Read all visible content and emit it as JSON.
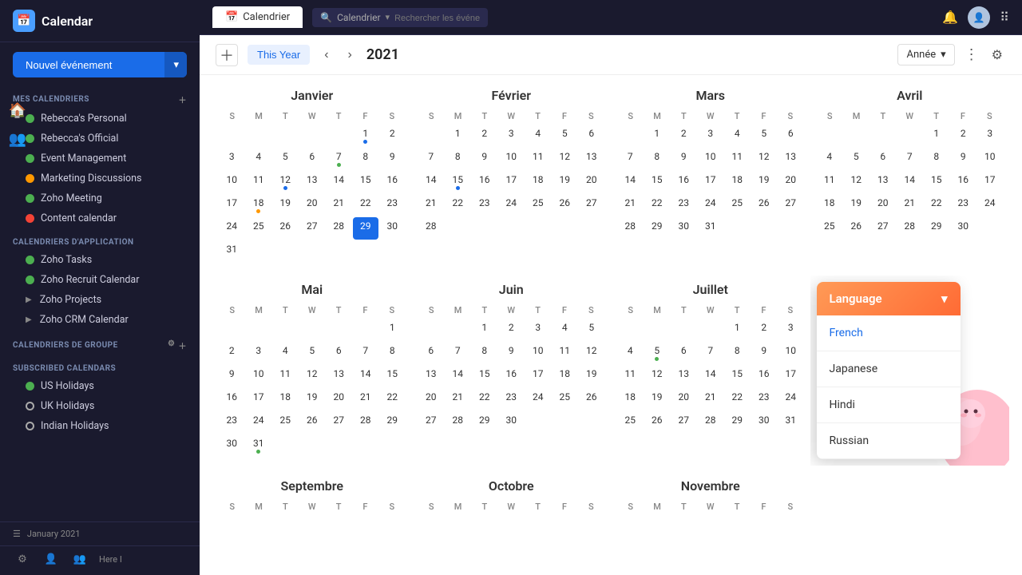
{
  "sidebar": {
    "app_name": "Calendar",
    "new_event_label": "Nouvel événement",
    "my_calendars_title": "MES CALENDRIERS",
    "my_calendars": [
      {
        "label": "Rebecca's Personal",
        "color": "green",
        "type": "dot"
      },
      {
        "label": "Rebecca's Official",
        "color": "green",
        "type": "dot"
      },
      {
        "label": "Event Management",
        "color": "green",
        "type": "dot"
      },
      {
        "label": "Marketing Discussions",
        "color": "orange",
        "type": "dot"
      },
      {
        "label": "Zoho Meeting",
        "color": "green",
        "type": "dot"
      },
      {
        "label": "Content calendar",
        "color": "red",
        "type": "dot"
      }
    ],
    "app_calendars_title": "CALENDRIERS D'APPLICATION",
    "app_calendars": [
      {
        "label": "Zoho Tasks",
        "color": "green",
        "type": "dot"
      },
      {
        "label": "Zoho Recruit Calendar",
        "color": "green",
        "type": "dot"
      },
      {
        "label": "Zoho Projects",
        "type": "arrow"
      },
      {
        "label": "Zoho CRM Calendar",
        "type": "arrow"
      }
    ],
    "group_calendars_title": "CALENDRIERS DE GROUPE",
    "subscribed_calendars_title": "SUBSCRIBED CALENDARS",
    "subscribed_calendars": [
      {
        "label": "US Holidays",
        "color": "green",
        "type": "dot"
      },
      {
        "label": "UK Holidays",
        "color": "outline",
        "type": "dot"
      },
      {
        "label": "Indian Holidays",
        "color": "outline",
        "type": "dot"
      }
    ],
    "mini_nav_label": "January 2021"
  },
  "topbar": {
    "tab_label": "Calendrier",
    "search_placeholder": "Rechercher les événeme...",
    "app_name": "Calendrier"
  },
  "toolbar": {
    "this_year": "This Year",
    "year": "2021",
    "view_label": "Année"
  },
  "months": [
    {
      "name": "Janvier",
      "days_header": [
        "S",
        "M",
        "T",
        "W",
        "T",
        "F",
        "S"
      ],
      "weeks": [
        [
          null,
          null,
          null,
          null,
          null,
          1,
          2
        ],
        [
          3,
          4,
          5,
          6,
          7,
          8,
          9
        ],
        [
          10,
          11,
          12,
          13,
          14,
          15,
          16
        ],
        [
          17,
          18,
          19,
          20,
          21,
          22,
          23
        ],
        [
          24,
          25,
          26,
          27,
          28,
          29,
          30
        ],
        [
          31,
          null,
          null,
          null,
          null,
          null,
          null
        ]
      ],
      "dots": {
        "1": "blue",
        "7": "green",
        "12": "blue",
        "18": "orange",
        "29": "today"
      }
    },
    {
      "name": "Février",
      "days_header": [
        "S",
        "M",
        "T",
        "W",
        "T",
        "F",
        "S"
      ],
      "weeks": [
        [
          null,
          1,
          2,
          3,
          4,
          5,
          6
        ],
        [
          7,
          8,
          9,
          10,
          11,
          12,
          13
        ],
        [
          14,
          15,
          16,
          17,
          18,
          19,
          20
        ],
        [
          21,
          22,
          23,
          24,
          25,
          26,
          27
        ],
        [
          28,
          null,
          null,
          null,
          null,
          null,
          null
        ]
      ],
      "dots": {
        "15": "blue"
      }
    },
    {
      "name": "Mars",
      "days_header": [
        "S",
        "M",
        "T",
        "W",
        "T",
        "F",
        "S"
      ],
      "weeks": [
        [
          null,
          1,
          2,
          3,
          4,
          5,
          6
        ],
        [
          7,
          8,
          9,
          10,
          11,
          12,
          13
        ],
        [
          14,
          15,
          16,
          17,
          18,
          19,
          20
        ],
        [
          21,
          22,
          23,
          24,
          25,
          26,
          27
        ],
        [
          28,
          29,
          30,
          31,
          null,
          null,
          null
        ]
      ],
      "dots": {}
    },
    {
      "name": "Avril",
      "days_header": [
        "S",
        "M",
        "T"
      ],
      "partial": true,
      "weeks": [
        [
          null,
          null,
          null,
          null,
          1,
          2,
          3
        ],
        [
          4,
          5,
          6,
          7,
          8,
          9,
          10
        ],
        [
          11,
          12,
          13,
          14,
          15,
          16,
          17
        ],
        [
          18,
          19,
          20,
          21,
          22,
          23,
          24
        ],
        [
          25,
          26,
          27,
          28,
          29,
          30,
          null
        ]
      ],
      "dots": {}
    },
    {
      "name": "Mai",
      "days_header": [
        "S",
        "M",
        "T",
        "W",
        "T",
        "F",
        "S"
      ],
      "weeks": [
        [
          null,
          null,
          null,
          null,
          null,
          null,
          1
        ],
        [
          2,
          3,
          4,
          5,
          6,
          7,
          8
        ],
        [
          9,
          10,
          11,
          12,
          13,
          14,
          15
        ],
        [
          16,
          17,
          18,
          19,
          20,
          21,
          22
        ],
        [
          23,
          24,
          25,
          26,
          27,
          28,
          29
        ],
        [
          30,
          31,
          null,
          null,
          null,
          null,
          null
        ]
      ],
      "dots": {}
    },
    {
      "name": "Juin",
      "days_header": [
        "S",
        "M",
        "T",
        "W",
        "T",
        "F",
        "S"
      ],
      "weeks": [
        [
          null,
          null,
          1,
          2,
          3,
          4,
          5
        ],
        [
          6,
          7,
          8,
          9,
          10,
          11,
          12
        ],
        [
          13,
          14,
          15,
          16,
          17,
          18,
          19
        ],
        [
          20,
          21,
          22,
          23,
          24,
          25,
          26
        ],
        [
          27,
          28,
          29,
          30,
          null,
          null,
          null
        ]
      ],
      "dots": {}
    },
    {
      "name": "Juillet",
      "days_header": [
        "S",
        "M",
        "T",
        "W",
        "T",
        "F",
        "S"
      ],
      "weeks": [
        [
          null,
          null,
          null,
          null,
          1,
          2,
          3
        ],
        [
          4,
          5,
          6,
          7,
          8,
          9,
          10
        ],
        [
          11,
          12,
          13,
          14,
          15,
          16,
          17
        ],
        [
          18,
          19,
          20,
          21,
          22,
          23,
          24
        ],
        [
          25,
          26,
          27,
          28,
          29,
          30,
          31
        ]
      ],
      "dots": {
        "5": "green"
      }
    },
    {
      "name": "Septembre",
      "days_header": [
        "S",
        "M",
        "T",
        "W",
        "T",
        "F",
        "S"
      ],
      "weeks": [],
      "dots": {}
    },
    {
      "name": "Octobre",
      "days_header": [
        "S",
        "M",
        "T",
        "W",
        "T",
        "F",
        "S"
      ],
      "weeks": [],
      "dots": {}
    },
    {
      "name": "Novembre",
      "days_header": [
        "S",
        "M",
        "T",
        "W",
        "T",
        "F",
        "S"
      ],
      "weeks": [],
      "dots": {}
    }
  ],
  "language_dropdown": {
    "title": "Language",
    "options": [
      "French",
      "Japanese",
      "Hindi",
      "Russian"
    ]
  }
}
